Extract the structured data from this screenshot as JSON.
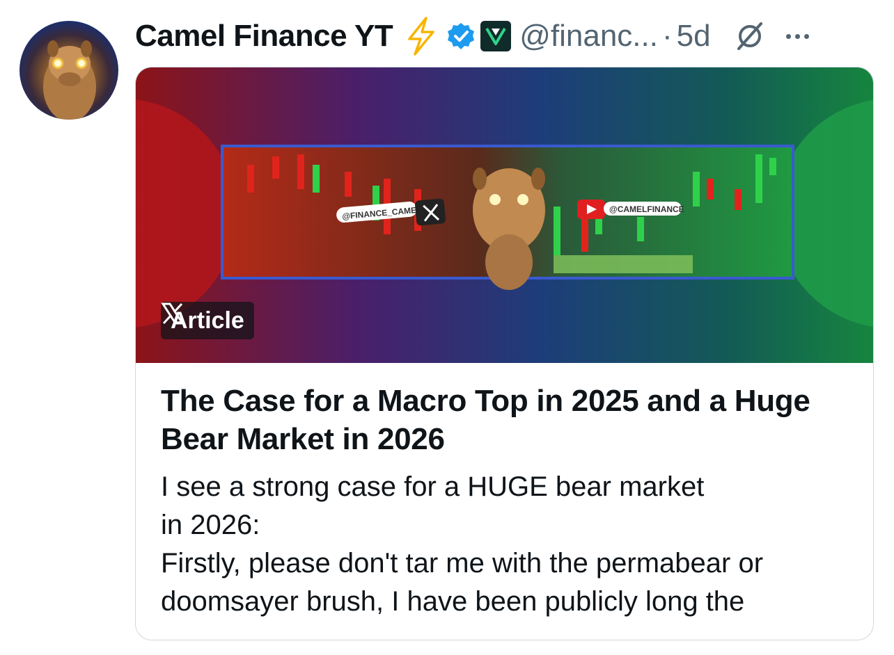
{
  "tweet": {
    "author_name": "Camel Finance YT",
    "handle": "@financ...",
    "separator": "·",
    "time": "5d",
    "colors": {
      "verified": "#1d9bf0",
      "bolt": "#f7b500",
      "muted": "#536471"
    }
  },
  "article": {
    "badge_label": "Article",
    "banner_text": {
      "left_tag": "@FINANCE_CAMEL",
      "right_tag": "@CAMELFINANCE"
    },
    "title": "The Case for a Macro Top in 2025 and a Huge Bear Market in 2026",
    "body_lines": [
      "I see a strong case for a HUGE bear market",
      "in 2026:",
      "Firstly, please don't tar me with the permabear or",
      "doomsayer brush, I have been publicly long the"
    ]
  }
}
